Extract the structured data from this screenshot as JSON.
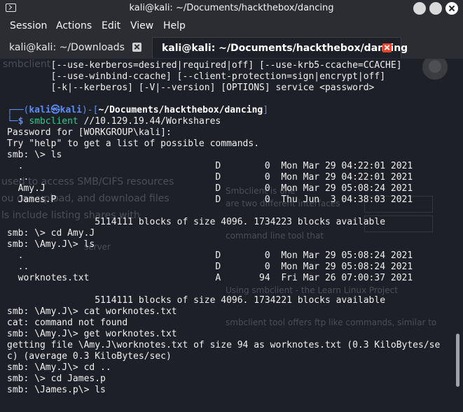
{
  "window": {
    "title": "kali@kali: ~/Documents/hackthebox/dancing"
  },
  "menu": {
    "items": [
      "Session",
      "Actions",
      "Edit",
      "View",
      "Help"
    ]
  },
  "tabs": [
    {
      "label": "kali@kali: ~/Downloads",
      "active": false
    },
    {
      "label": "kali@kali: ~/Documents/hackthebox/dancing",
      "active": true
    }
  ],
  "terminal": {
    "usage_lines": [
      "        [--use-kerberos=desired|required|off] [--use-krb5-ccache=CCACHE]",
      "        [--use-winbind-ccache] [--client-protection=sign|encrypt|off]",
      "        [-k|--kerberos] [-V|--version] [OPTIONS] service <password>"
    ],
    "prompt": {
      "user": "kali",
      "skull": "㉿",
      "host": "kali",
      "path": "~/Documents/hackthebox/dancing",
      "dollar": "$",
      "command_name": "smbclient",
      "command_args": " //10.129.19.44/Workshares"
    },
    "output": [
      "Password for [WORKGROUP\\kali]:",
      "Try \"help\" to get a list of possible commands.",
      "smb: \\> ls",
      "  .                                   D        0  Mon Mar 29 04:22:01 2021",
      "  ..                                  D        0  Mon Mar 29 04:22:01 2021",
      "  Amy.J                               D        0  Mon Mar 29 05:08:24 2021",
      "  James.P                             D        0  Thu Jun  3 04:38:03 2021",
      "",
      "                5114111 blocks of size 4096. 1734223 blocks available",
      "smb: \\> cd Amy.J",
      "smb: \\Amy.J\\> ls",
      "  .                                   D        0  Mon Mar 29 05:08:24 2021",
      "  ..                                  D        0  Mon Mar 29 05:08:24 2021",
      "  worknotes.txt                       A       94  Fri Mar 26 07:00:37 2021",
      "",
      "                5114111 blocks of size 4096. 1734221 blocks available",
      "smb: \\Amy.J\\> cat worknotes.txt",
      "cat: command not found",
      "smb: \\Amy.J\\> get worknotes.txt",
      "getting file \\Amy.J\\worknotes.txt of size 94 as worknotes.txt (0.3 KiloBytes/se",
      "c) (average 0.3 KiloBytes/sec)",
      "smb: \\Amy.J\\> cd ..",
      "smb: \\> cd James.p",
      "smb: \\James.p\\> ls"
    ]
  },
  "background_ghost": {
    "texts": [
      "smbclient",
      "used to access SMB/CIFS resources",
      "ou can upload, and download files",
      "ls include listing shares with",
      "Smbclient is one",
      "are two different interfaces",
      "command line tool that",
      "Using smbclient - the Learn Linux Project",
      "smbclient tool offers ftp like commands, similar to",
      "server"
    ]
  },
  "colors": {
    "terminal_bg": "#1e2027",
    "chrome_bg": "#2b2d33",
    "prompt_blue": "#5a8dfa",
    "prompt_green": "#35c78d",
    "command_cyan": "#48b9c7",
    "tab_close_red": "#e8432c"
  }
}
